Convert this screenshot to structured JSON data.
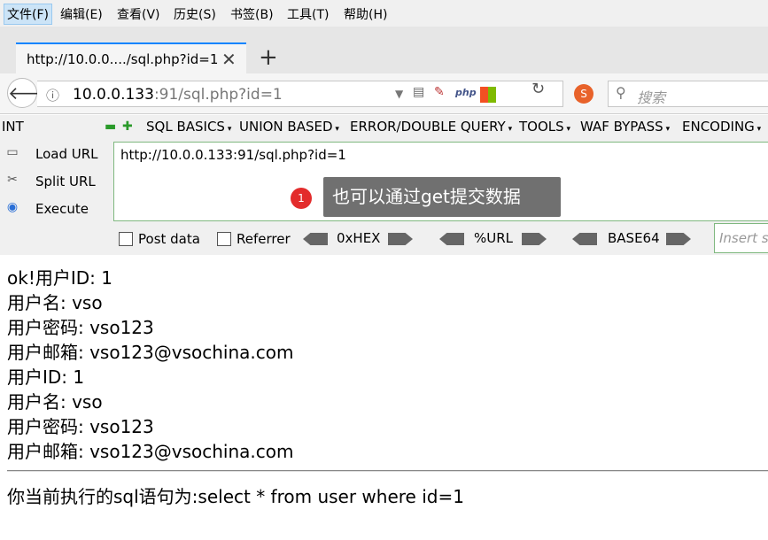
{
  "menubar": {
    "items": [
      "文件(F)",
      "编辑(E)",
      "查看(V)",
      "历史(S)",
      "书签(B)",
      "工具(T)",
      "帮助(H)"
    ]
  },
  "tab": {
    "title": "http://10.0.0..../sql.php?id=1",
    "close": "✕"
  },
  "newtab": "+",
  "address": {
    "host": "10.0.0.133",
    "port": ":91/sql.php?id=1",
    "php_label": "php"
  },
  "search": {
    "placeholder": "搜索"
  },
  "hackbar": {
    "select": "INT",
    "menus": [
      "SQL BASICS",
      "UNION BASED",
      "ERROR/DOUBLE QUERY",
      "TOOLS",
      "WAF BYPASS",
      "ENCODING"
    ],
    "load_url": "Load URL",
    "split_url": "Split URL",
    "execute": "Execute",
    "url_value": "http://10.0.0.133:91/sql.php?id=1",
    "post_data": "Post data",
    "referrer": "Referrer",
    "hex": "0xHEX",
    "url_enc": "%URL",
    "base64": "BASE64",
    "insert_placeholder": "Insert st"
  },
  "annotation": {
    "number": "1",
    "text": "也可以通过get提交数据"
  },
  "content": {
    "lines": [
      "ok!用户ID: 1",
      "用户名: vso",
      "用户密码: vso123",
      "用户邮箱: vso123@vsochina.com",
      "用户ID: 1",
      "用户名: vso",
      "用户密码: vso123",
      "用户邮箱: vso123@vsochina.com"
    ],
    "sql": "你当前执行的sql语句为:select * from user where id=1"
  }
}
